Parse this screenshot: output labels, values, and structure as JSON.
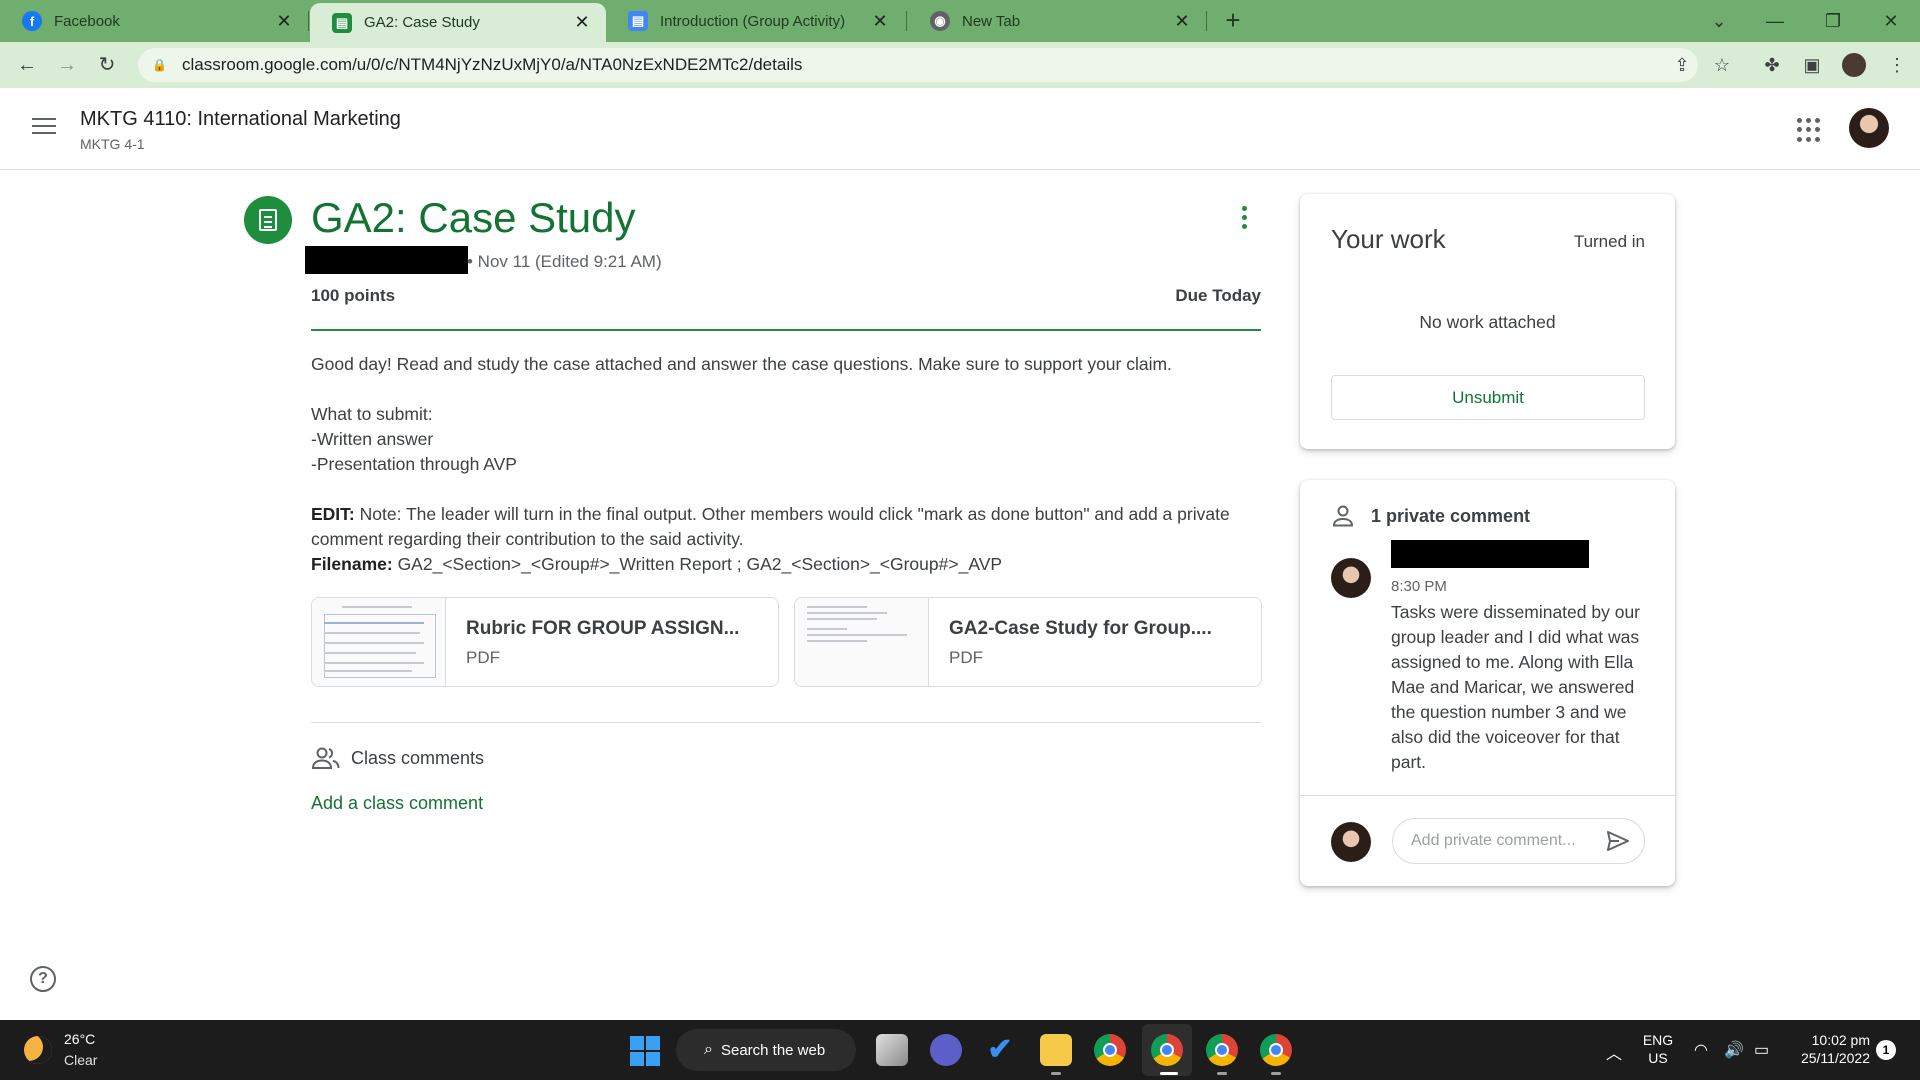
{
  "browser": {
    "tabs": [
      {
        "label": "Facebook",
        "favicon": "facebook-icon",
        "color": "#1877f2"
      },
      {
        "label": "GA2: Case Study",
        "favicon": "classroom-icon",
        "color": "#1e8e3e",
        "active": true
      },
      {
        "label": "Introduction (Group Activity)",
        "favicon": "classroom-icon",
        "color": "#4285f4"
      },
      {
        "label": "New Tab",
        "favicon": "chrome-icon",
        "color": "#5f6368"
      }
    ],
    "url": "classroom.google.com/u/0/c/NTM4NjYzNzUxMjY0/a/NTA0NzExNDE2MTc2/details"
  },
  "header": {
    "course_title": "MKTG 4110: International Marketing",
    "course_section": "MKTG 4-1"
  },
  "assignment": {
    "title": "GA2: Case Study",
    "date": "• Nov 11 (Edited 9:21 AM)",
    "points": "100 points",
    "due": "Due Today",
    "instructions": {
      "line1": "Good day! Read and study the case attached and answer the case questions. Make sure to support your claim.",
      "line2": "What to submit:",
      "line3": "-Written answer",
      "line4": "-Presentation through AVP",
      "edit_label": "EDIT:",
      "edit_text": " Note: The leader will turn in the final output. Other members would click \"mark as done button\" and add a private comment regarding their contribution to the said activity.",
      "filename_label": "Filename:",
      "filename_text": " GA2_<Section>_<Group#>_Written Report ; GA2_<Section>_<Group#>_AVP"
    },
    "attachments": [
      {
        "name": "Rubric FOR GROUP ASSIGN...",
        "type": "PDF"
      },
      {
        "name": "GA2-Case Study for Group....",
        "type": "PDF"
      }
    ],
    "class_comments_label": "Class comments",
    "add_class_comment": "Add a class comment"
  },
  "your_work": {
    "title": "Your work",
    "status": "Turned in",
    "empty": "No work attached",
    "unsubmit": "Unsubmit"
  },
  "private_comments": {
    "title": "1 private comment",
    "time": "8:30 PM",
    "text": "Tasks were disseminated by our group leader and I did what was assigned to me. Along with Ella Mae and Maricar, we answered the question number 3 and we also did the voiceover for that part.",
    "placeholder": "Add private comment..."
  },
  "taskbar": {
    "temp": "26°C",
    "condition": "Clear",
    "search": "Search the web",
    "lang1": "ENG",
    "lang2": "US",
    "time": "10:02 pm",
    "date": "25/11/2022",
    "notifications": "1"
  },
  "colors": {
    "accent": "#137333",
    "accent_bright": "#1e8e3e",
    "tabbar": "#6fae6f",
    "toolbar": "#d9ecd5"
  }
}
